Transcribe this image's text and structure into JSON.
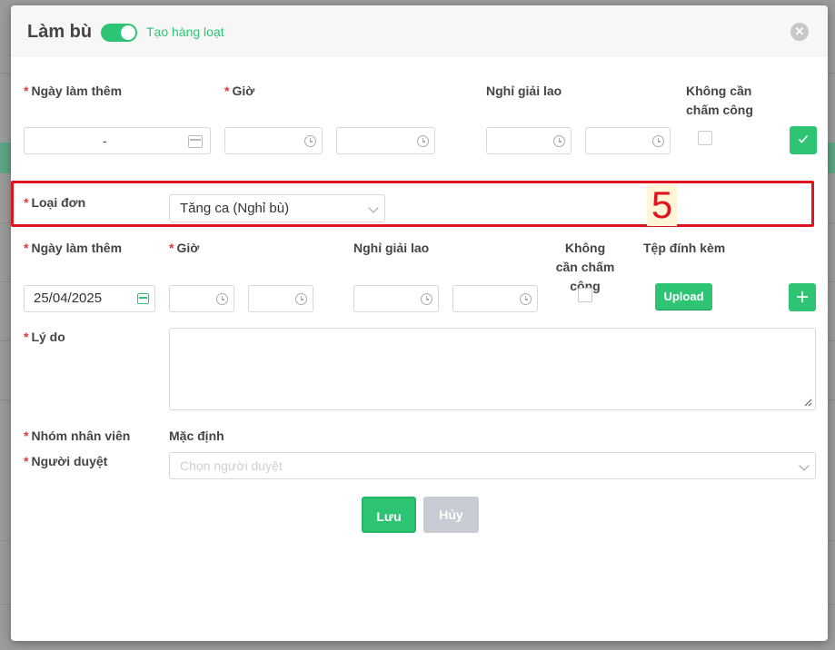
{
  "modal": {
    "title": "Làm bù",
    "toggle_label": "Tạo hàng loạt",
    "close_glyph": "✕"
  },
  "row1": {
    "date_label": "Ngày làm thêm",
    "time_label": "Giờ",
    "break_label": "Nghỉ giải lao",
    "no_timekeeping_label": "Không cần chấm công",
    "date_value": "-"
  },
  "type": {
    "label": "Loại đơn",
    "selected": "Tăng ca (Nghỉ bù)"
  },
  "step_marker": "5",
  "row2": {
    "date_label": "Ngày làm thêm",
    "time_label": "Giờ",
    "break_label": "Nghỉ giải lao",
    "no_timekeeping_label": "Không cần chấm công",
    "attachment_label": "Tệp đính kèm",
    "date_value": "25/04/2025",
    "upload_label": "Upload"
  },
  "reason": {
    "label": "Lý do"
  },
  "group": {
    "label": "Nhóm nhân viên",
    "value": "Mặc định"
  },
  "approver": {
    "label": "Người duyệt",
    "placeholder": "Chọn người duyệt"
  },
  "actions": {
    "save": "Lưu",
    "cancel": "Hủy"
  },
  "colors": {
    "accent": "#2dc574",
    "required": "#e53935",
    "highlight": "#e0141e"
  }
}
